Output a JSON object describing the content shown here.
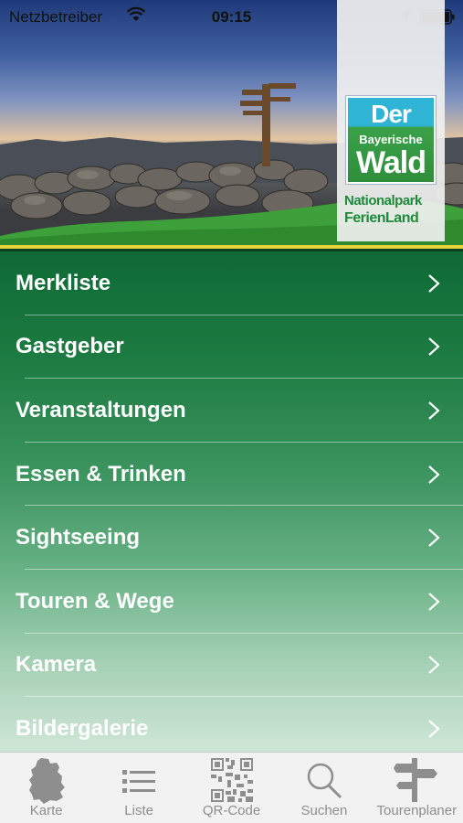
{
  "status_bar": {
    "carrier": "Netzbetreiber",
    "time": "09:15"
  },
  "logo": {
    "line1": "Der",
    "line2": "Bayerische",
    "line3": "Wald",
    "line4": "Nationalpark",
    "line5": "FerienLand"
  },
  "menu": {
    "items": [
      {
        "label": "Merkliste"
      },
      {
        "label": "Gastgeber"
      },
      {
        "label": "Veranstaltungen"
      },
      {
        "label": "Essen & Trinken"
      },
      {
        "label": "Sightseeing"
      },
      {
        "label": "Touren & Wege"
      },
      {
        "label": "Kamera"
      },
      {
        "label": "Bildergalerie"
      }
    ]
  },
  "tabbar": {
    "tabs": [
      {
        "label": "Karte",
        "icon": "germany-map-icon"
      },
      {
        "label": "Liste",
        "icon": "list-icon"
      },
      {
        "label": "QR-Code",
        "icon": "qr-code-icon"
      },
      {
        "label": "Suchen",
        "icon": "search-icon"
      },
      {
        "label": "Tourenplaner",
        "icon": "signpost-icon"
      }
    ]
  },
  "colors": {
    "menu_green": "#0f6a35",
    "accent_yellow": "#e8d43a",
    "logo_green": "#1d8a3c",
    "logo_blue": "#2fb4d6"
  }
}
